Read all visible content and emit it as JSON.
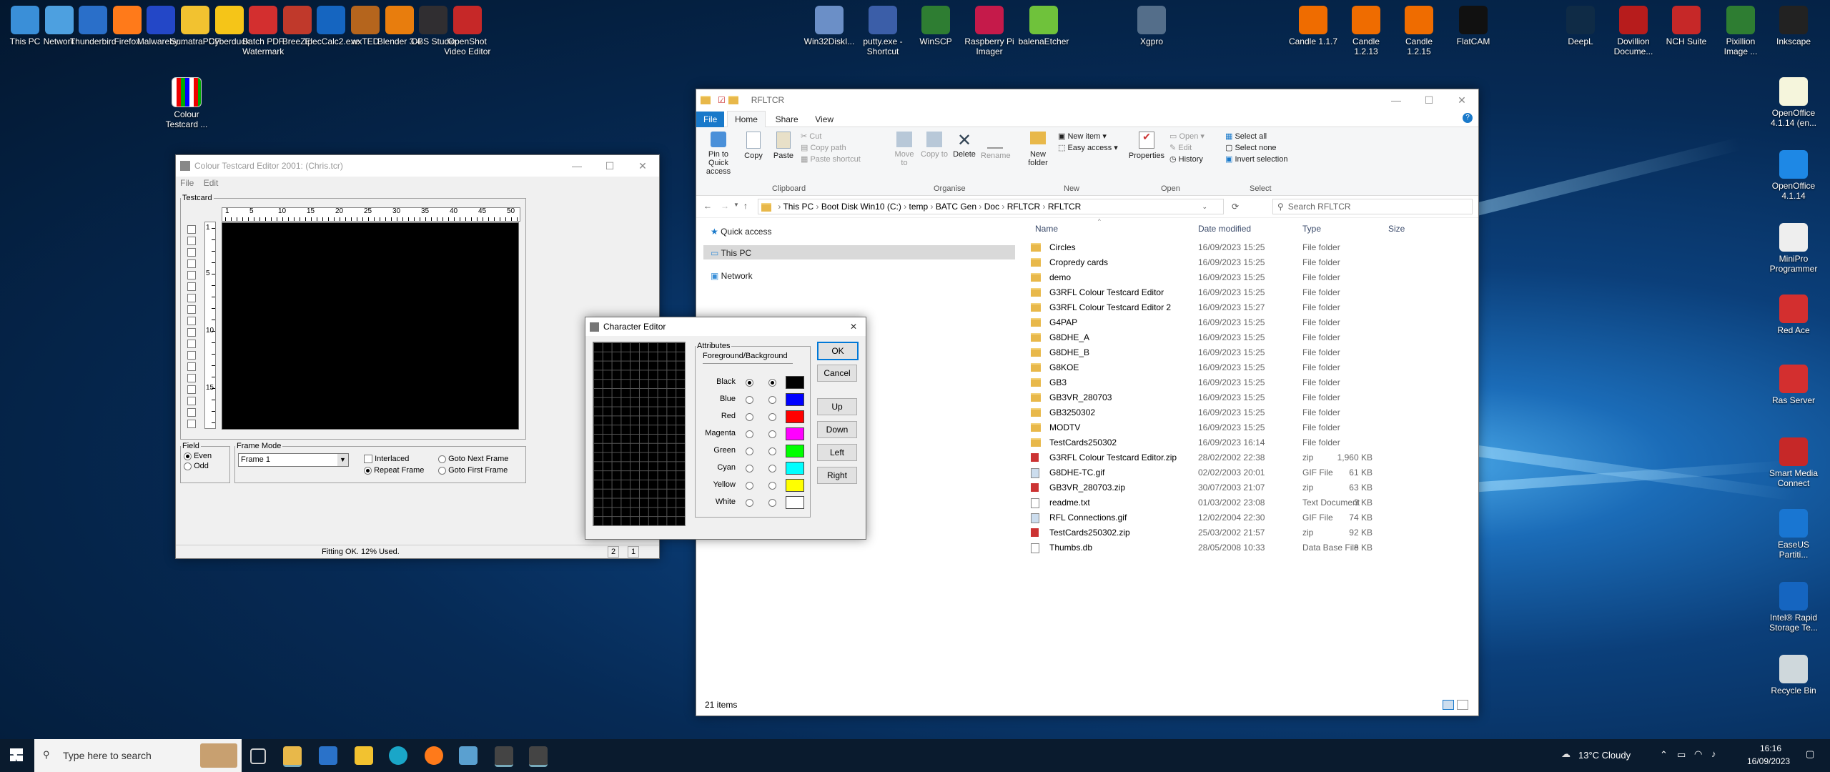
{
  "desktop_left": [
    {
      "label": "This PC",
      "color": "#3a8fd8"
    },
    {
      "label": "Network",
      "color": "#4da0e0"
    },
    {
      "label": "Thunderbird",
      "color": "#2a6fc9"
    },
    {
      "label": "Firefox",
      "color": "#ff7a1a"
    },
    {
      "label": "Malwareby...",
      "color": "#2347c7"
    },
    {
      "label": "SumatraPDF",
      "color": "#f2c230"
    },
    {
      "label": "Cyberduck",
      "color": "#f5c518"
    },
    {
      "label": "Batch PDF Watermark",
      "color": "#d32f2f"
    },
    {
      "label": "BreeZip",
      "color": "#c0392b"
    },
    {
      "label": "ElecCalc2.exe",
      "color": "#1565c0"
    },
    {
      "label": "wxTED",
      "color": "#b5651d"
    },
    {
      "label": "Blender 3.4",
      "color": "#e87d0d"
    },
    {
      "label": "OBS Studio",
      "color": "#302e31"
    },
    {
      "label": "OpenShot Video Editor",
      "color": "#c62828"
    }
  ],
  "desktop_mid": [
    {
      "label": "Win32DiskI... ",
      "color": "#6b8fc7"
    },
    {
      "label": "putty.exe - Shortcut",
      "color": "#3b5ea8"
    },
    {
      "label": "WinSCP",
      "color": "#2e7d32"
    },
    {
      "label": "Raspberry Pi Imager",
      "color": "#c51a4a"
    },
    {
      "label": "balenaEtcher",
      "color": "#6fc23b"
    },
    {
      "label": "Xgpro",
      "color": "#546e8a"
    }
  ],
  "desktop_right_top": [
    {
      "label": "Candle 1.1.7",
      "color": "#ef6c00"
    },
    {
      "label": "Candle 1.2.13",
      "color": "#ef6c00"
    },
    {
      "label": "Candle 1.2.15",
      "color": "#ef6c00"
    },
    {
      "label": "FlatCAM",
      "color": "#111111"
    },
    {
      "label": "DeepL",
      "color": "#0f2b46"
    },
    {
      "label": "Dovillion Docume...",
      "color": "#b71c1c"
    },
    {
      "label": "NCH Suite",
      "color": "#c62828"
    },
    {
      "label": "Pixillion Image ...",
      "color": "#2e7d32"
    },
    {
      "label": "Inkscape",
      "color": "#222222"
    }
  ],
  "desktop_right_col": [
    {
      "label": "OpenOffice 4.1.14 (en...",
      "color": "#f5f5dc"
    },
    {
      "label": "OpenOffice 4.1.14",
      "color": "#1e88e5"
    },
    {
      "label": "MiniPro Programmer",
      "color": "#eeeeee"
    },
    {
      "label": "Red Ace",
      "color": "#d32f2f"
    },
    {
      "label": "Ras Server",
      "color": "#d32f2f"
    },
    {
      "label": "Smart Media Connect",
      "color": "#c62828"
    },
    {
      "label": "EaseUS Partiti...",
      "color": "#1976d2"
    },
    {
      "label": "Intel® Rapid Storage Te...",
      "color": "#1565c0"
    },
    {
      "label": "Recycle Bin",
      "color": "#cfd8dc"
    }
  ],
  "colour_testcard_icon": {
    "label": "Colour Testcard ..."
  },
  "testcard_window": {
    "title": "Colour Testcard Editor 2001: (Chris.tcr)",
    "menu": [
      "File",
      "Edit"
    ],
    "group_label": "Testcard",
    "ruler_ticks": [
      "1",
      "5",
      "10",
      "15",
      "20",
      "25",
      "30",
      "35",
      "40",
      "45",
      "50"
    ],
    "row_ticks": [
      "1",
      "5",
      "10",
      "15"
    ],
    "field_label": "Field",
    "field_even": "Even",
    "field_odd": "Odd",
    "frame_mode_label": "Frame Mode",
    "frame_select": "Frame 1",
    "interlaced": "Interlaced",
    "repeat_frame": "Repeat Frame",
    "goto_next": "Goto Next Frame",
    "goto_first": "Goto First Frame",
    "status": "Fitting OK.  12% Used.",
    "status_a": "2",
    "status_b": "1"
  },
  "char_editor": {
    "title": "Character Editor",
    "attributes_label": "Attributes",
    "fg_bg_label": "Foreground/Background",
    "colours": [
      {
        "name": "Black",
        "swatch": "#000000",
        "fg": true,
        "bg": true
      },
      {
        "name": "Blue",
        "swatch": "#0000ff",
        "fg": false,
        "bg": false
      },
      {
        "name": "Red",
        "swatch": "#ff0000",
        "fg": false,
        "bg": false
      },
      {
        "name": "Magenta",
        "swatch": "#ff00ff",
        "fg": false,
        "bg": false
      },
      {
        "name": "Green",
        "swatch": "#00ff00",
        "fg": false,
        "bg": false
      },
      {
        "name": "Cyan",
        "swatch": "#00ffff",
        "fg": false,
        "bg": false
      },
      {
        "name": "Yellow",
        "swatch": "#ffff00",
        "fg": false,
        "bg": false
      },
      {
        "name": "White",
        "swatch": "#ffffff",
        "fg": false,
        "bg": false
      }
    ],
    "ok": "OK",
    "cancel": "Cancel",
    "up": "Up",
    "down": "Down",
    "left": "Left",
    "right": "Right"
  },
  "explorer": {
    "title": "RFLTCR",
    "tabs": [
      "File",
      "Home",
      "Share",
      "View"
    ],
    "clipboard": {
      "pin": "Pin to Quick access",
      "copy": "Copy",
      "paste": "Paste",
      "cut": "Cut",
      "copy_path": "Copy path",
      "paste_shortcut": "Paste shortcut",
      "group": "Clipboard"
    },
    "organise": {
      "move": "Move to",
      "copy_to": "Copy to",
      "delete": "Delete",
      "rename": "Rename",
      "group": "Organise"
    },
    "new": {
      "folder": "New folder",
      "item": "New item",
      "easy": "Easy access",
      "group": "New"
    },
    "open": {
      "properties": "Properties",
      "open": "Open",
      "edit": "Edit",
      "history": "History",
      "group": "Open"
    },
    "select": {
      "all": "Select all",
      "none": "Select none",
      "invert": "Invert selection",
      "group": "Select"
    },
    "breadcrumb": [
      "This PC",
      "Boot Disk Win10 (C:)",
      "temp",
      "BATC Gen",
      "Doc",
      "RFLTCR",
      "RFLTCR"
    ],
    "search_placeholder": "Search RFLTCR",
    "nav": [
      "Quick access",
      "This PC",
      "Network"
    ],
    "columns": [
      "Name",
      "Date modified",
      "Type",
      "Size"
    ],
    "files": [
      {
        "name": "Circles",
        "date": "16/09/2023 15:25",
        "type": "File folder",
        "size": "",
        "kind": "folder"
      },
      {
        "name": "Cropredy cards",
        "date": "16/09/2023 15:25",
        "type": "File folder",
        "size": "",
        "kind": "folder"
      },
      {
        "name": "demo",
        "date": "16/09/2023 15:25",
        "type": "File folder",
        "size": "",
        "kind": "folder"
      },
      {
        "name": "G3RFL Colour Testcard Editor",
        "date": "16/09/2023 15:25",
        "type": "File folder",
        "size": "",
        "kind": "folder"
      },
      {
        "name": "G3RFL Colour Testcard Editor 2",
        "date": "16/09/2023 15:27",
        "type": "File folder",
        "size": "",
        "kind": "folder"
      },
      {
        "name": "G4PAP",
        "date": "16/09/2023 15:25",
        "type": "File folder",
        "size": "",
        "kind": "folder"
      },
      {
        "name": "G8DHE_A",
        "date": "16/09/2023 15:25",
        "type": "File folder",
        "size": "",
        "kind": "folder"
      },
      {
        "name": "G8DHE_B",
        "date": "16/09/2023 15:25",
        "type": "File folder",
        "size": "",
        "kind": "folder"
      },
      {
        "name": "G8KOE",
        "date": "16/09/2023 15:25",
        "type": "File folder",
        "size": "",
        "kind": "folder"
      },
      {
        "name": "GB3",
        "date": "16/09/2023 15:25",
        "type": "File folder",
        "size": "",
        "kind": "folder"
      },
      {
        "name": "GB3VR_280703",
        "date": "16/09/2023 15:25",
        "type": "File folder",
        "size": "",
        "kind": "folder"
      },
      {
        "name": "GB3250302",
        "date": "16/09/2023 15:25",
        "type": "File folder",
        "size": "",
        "kind": "folder"
      },
      {
        "name": "MODTV",
        "date": "16/09/2023 15:25",
        "type": "File folder",
        "size": "",
        "kind": "folder"
      },
      {
        "name": "TestCards250302",
        "date": "16/09/2023 16:14",
        "type": "File folder",
        "size": "",
        "kind": "folder"
      },
      {
        "name": "G3RFL Colour Testcard Editor.zip",
        "date": "28/02/2002 22:38",
        "type": "zip",
        "size": "1,960 KB",
        "kind": "zip"
      },
      {
        "name": "G8DHE-TC.gif",
        "date": "02/02/2003 20:01",
        "type": "GIF File",
        "size": "61 KB",
        "kind": "gif"
      },
      {
        "name": "GB3VR_280703.zip",
        "date": "30/07/2003 21:07",
        "type": "zip",
        "size": "63 KB",
        "kind": "zip"
      },
      {
        "name": "readme.txt",
        "date": "01/03/2002 23:08",
        "type": "Text Document",
        "size": "3 KB",
        "kind": "file"
      },
      {
        "name": "RFL Connections.gif",
        "date": "12/02/2004 22:30",
        "type": "GIF File",
        "size": "74 KB",
        "kind": "gif"
      },
      {
        "name": "TestCards250302.zip",
        "date": "25/03/2002 21:57",
        "type": "zip",
        "size": "92 KB",
        "kind": "zip"
      },
      {
        "name": "Thumbs.db",
        "date": "28/05/2008 10:33",
        "type": "Data Base File",
        "size": "8 KB",
        "kind": "file"
      }
    ],
    "status": "21 items"
  },
  "taskbar": {
    "search_placeholder": "Type here to search",
    "weather": "13°C  Cloudy",
    "time": "16:16",
    "date": "16/09/2023"
  }
}
